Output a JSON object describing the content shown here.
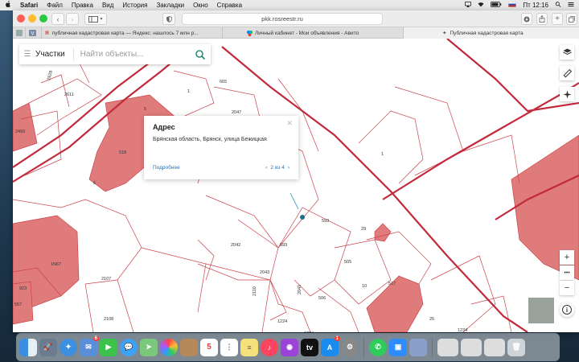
{
  "menubar": {
    "apple": "",
    "app": "Safari",
    "items": [
      "Файл",
      "Правка",
      "Вид",
      "История",
      "Закладки",
      "Окно",
      "Справка"
    ],
    "clock": "Пт 12:16"
  },
  "toolbar": {
    "back": "‹",
    "forward": "›",
    "address": "pkk.rosreestr.ru"
  },
  "tabs": [
    {
      "label": "публичная кадастровая карта — Яндекс: нашлось 7 млн р..."
    },
    {
      "label": "Личный кабинет - Мои объявления - Авито"
    },
    {
      "label": "Публичная кадастровая карта"
    }
  ],
  "search": {
    "category": "Участки",
    "placeholder": "Найти объекты..."
  },
  "popup": {
    "title": "Адрес",
    "address": "Брянская область, Брянск, улица Бежицкая",
    "more": "Подробнее",
    "pager": "2 из 4",
    "prev": "‹",
    "next": "›",
    "close": "✕"
  },
  "map": {
    "labels": [
      {
        "text": "2628",
        "name": "label-2628"
      },
      {
        "text": "2611",
        "name": "label-2611"
      },
      {
        "text": "2493",
        "name": "label-2493"
      },
      {
        "text": "1",
        "name": "label-1-top"
      },
      {
        "text": "665",
        "name": "label-665"
      },
      {
        "text": "2047",
        "name": "label-2047"
      },
      {
        "text": "5",
        "name": "label-5"
      },
      {
        "text": "518",
        "name": "label-518"
      },
      {
        "text": "6",
        "name": "label-6"
      },
      {
        "text": "1",
        "name": "label-1-right"
      },
      {
        "text": "593",
        "name": "label-593-a"
      },
      {
        "text": "593",
        "name": "label-593-b"
      },
      {
        "text": "29",
        "name": "label-29"
      },
      {
        "text": "2042",
        "name": "label-2042"
      },
      {
        "text": "505",
        "name": "label-505"
      },
      {
        "text": "2043",
        "name": "label-2043"
      },
      {
        "text": "10",
        "name": "label-10"
      },
      {
        "text": "2107",
        "name": "label-2107"
      },
      {
        "text": "2110",
        "name": "label-2110"
      },
      {
        "text": "2041",
        "name": "label-2041"
      },
      {
        "text": "506",
        "name": "label-506"
      },
      {
        "text": "517",
        "name": "label-517"
      },
      {
        "text": "2108",
        "name": "label-2108"
      },
      {
        "text": "1224",
        "name": "label-1224-a"
      },
      {
        "text": "1224",
        "name": "label-1224-b"
      },
      {
        "text": "1234",
        "name": "label-1234"
      },
      {
        "text": "25",
        "name": "label-25"
      },
      {
        "text": "1N67",
        "name": "label-1n67"
      },
      {
        "text": "923",
        "name": "label-923"
      },
      {
        "text": "557",
        "name": "label-557"
      }
    ]
  },
  "controls": {
    "layers": "layers-icon",
    "ruler": "ruler-icon",
    "compass": "compass-icon",
    "zoom_in": "+",
    "more": "•••",
    "zoom_out": "−",
    "info": "i"
  },
  "dock": {
    "calendar_day": "5",
    "mail_badge": "6",
    "appstore_badge": "1"
  }
}
